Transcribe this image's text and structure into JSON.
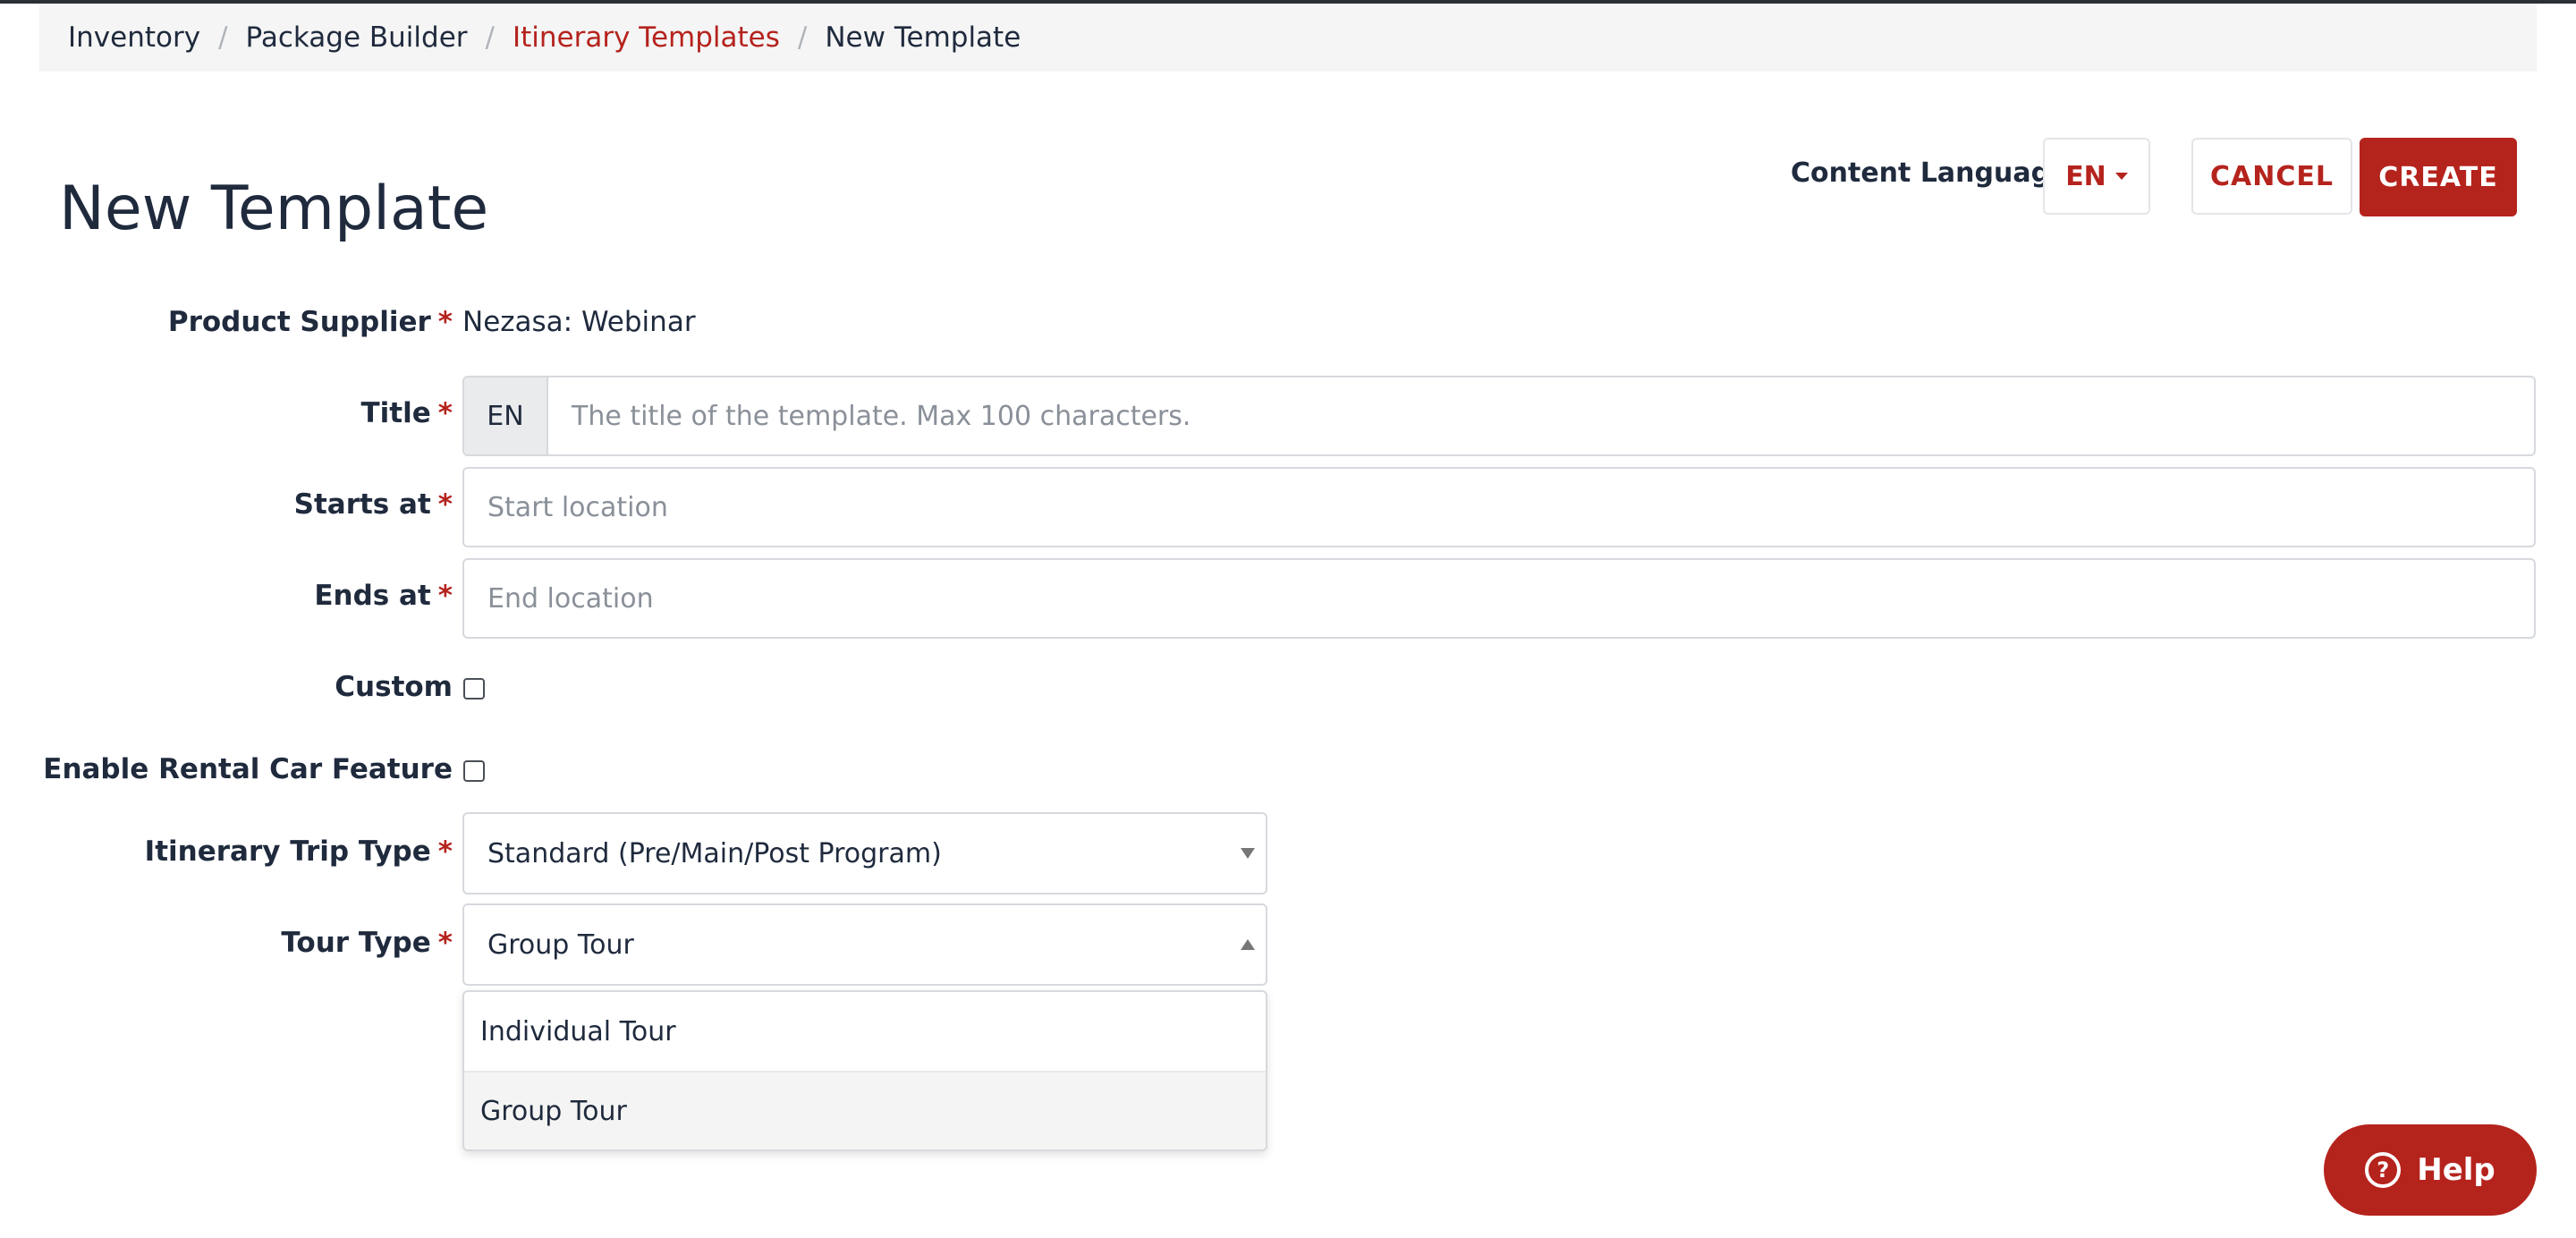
{
  "breadcrumb": {
    "items": [
      "Inventory",
      "Package Builder",
      "Itinerary Templates",
      "New Template"
    ],
    "separator": "/"
  },
  "page": {
    "title": "New Template"
  },
  "header_actions": {
    "content_language_label": "Content Language",
    "language_value": "EN",
    "cancel_label": "CANCEL",
    "create_label": "CREATE"
  },
  "form": {
    "required_marker": "*",
    "product_supplier": {
      "label": "Product Supplier",
      "value": "Nezasa: Webinar"
    },
    "title": {
      "label": "Title",
      "addon": "EN",
      "placeholder": "The title of the template. Max 100 characters."
    },
    "starts_at": {
      "label": "Starts at",
      "placeholder": "Start location"
    },
    "ends_at": {
      "label": "Ends at",
      "placeholder": "End location"
    },
    "custom": {
      "label": "Custom",
      "checked": false
    },
    "rental_car": {
      "label": "Enable Rental Car Feature",
      "checked": false
    },
    "trip_type": {
      "label": "Itinerary Trip Type",
      "value": "Standard (Pre/Main/Post Program)"
    },
    "tour_type": {
      "label": "Tour Type",
      "value": "Group Tour",
      "options": [
        "Individual Tour",
        "Group Tour"
      ]
    }
  },
  "help": {
    "label": "Help",
    "icon_glyph": "?"
  },
  "colors": {
    "accent": "#b5231d",
    "text": "#1f2a3d",
    "breadcrumb_bg": "#f5f5f5"
  }
}
